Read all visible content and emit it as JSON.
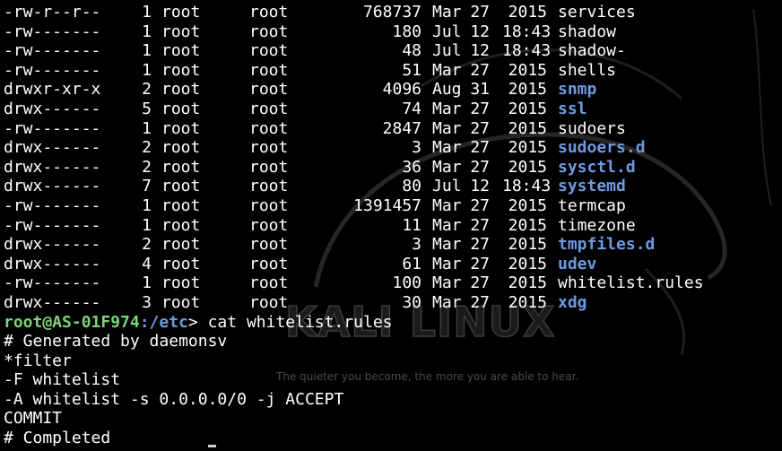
{
  "wallpaper": {
    "logo_text": "KALI LINUX",
    "tagline": "The quieter you become, the more you are able to hear."
  },
  "listing": [
    {
      "perm": "-rw-r--r--",
      "links": "1",
      "owner": "root",
      "group": "root",
      "size": "768737",
      "month": "Mar",
      "day": "27",
      "time": "2015",
      "name": "services",
      "is_dir": false
    },
    {
      "perm": "-rw-------",
      "links": "1",
      "owner": "root",
      "group": "root",
      "size": "180",
      "month": "Jul",
      "day": "12",
      "time": "18:43",
      "name": "shadow",
      "is_dir": false
    },
    {
      "perm": "-rw-------",
      "links": "1",
      "owner": "root",
      "group": "root",
      "size": "48",
      "month": "Jul",
      "day": "12",
      "time": "18:43",
      "name": "shadow-",
      "is_dir": false
    },
    {
      "perm": "-rw-------",
      "links": "1",
      "owner": "root",
      "group": "root",
      "size": "51",
      "month": "Mar",
      "day": "27",
      "time": "2015",
      "name": "shells",
      "is_dir": false
    },
    {
      "perm": "drwxr-xr-x",
      "links": "2",
      "owner": "root",
      "group": "root",
      "size": "4096",
      "month": "Aug",
      "day": "31",
      "time": "2015",
      "name": "snmp",
      "is_dir": true
    },
    {
      "perm": "drwx------",
      "links": "5",
      "owner": "root",
      "group": "root",
      "size": "74",
      "month": "Mar",
      "day": "27",
      "time": "2015",
      "name": "ssl",
      "is_dir": true
    },
    {
      "perm": "-rw-------",
      "links": "1",
      "owner": "root",
      "group": "root",
      "size": "2847",
      "month": "Mar",
      "day": "27",
      "time": "2015",
      "name": "sudoers",
      "is_dir": false
    },
    {
      "perm": "drwx------",
      "links": "2",
      "owner": "root",
      "group": "root",
      "size": "3",
      "month": "Mar",
      "day": "27",
      "time": "2015",
      "name": "sudoers.d",
      "is_dir": true
    },
    {
      "perm": "drwx------",
      "links": "2",
      "owner": "root",
      "group": "root",
      "size": "36",
      "month": "Mar",
      "day": "27",
      "time": "2015",
      "name": "sysctl.d",
      "is_dir": true
    },
    {
      "perm": "drwx------",
      "links": "7",
      "owner": "root",
      "group": "root",
      "size": "80",
      "month": "Jul",
      "day": "12",
      "time": "18:43",
      "name": "systemd",
      "is_dir": true
    },
    {
      "perm": "-rw-------",
      "links": "1",
      "owner": "root",
      "group": "root",
      "size": "1391457",
      "month": "Mar",
      "day": "27",
      "time": "2015",
      "name": "termcap",
      "is_dir": false
    },
    {
      "perm": "-rw-------",
      "links": "1",
      "owner": "root",
      "group": "root",
      "size": "11",
      "month": "Mar",
      "day": "27",
      "time": "2015",
      "name": "timezone",
      "is_dir": false
    },
    {
      "perm": "drwx------",
      "links": "2",
      "owner": "root",
      "group": "root",
      "size": "3",
      "month": "Mar",
      "day": "27",
      "time": "2015",
      "name": "tmpfiles.d",
      "is_dir": true
    },
    {
      "perm": "drwx------",
      "links": "4",
      "owner": "root",
      "group": "root",
      "size": "61",
      "month": "Mar",
      "day": "27",
      "time": "2015",
      "name": "udev",
      "is_dir": true
    },
    {
      "perm": "-rw-------",
      "links": "1",
      "owner": "root",
      "group": "root",
      "size": "100",
      "month": "Mar",
      "day": "27",
      "time": "2015",
      "name": "whitelist.rules",
      "is_dir": false
    },
    {
      "perm": "drwx------",
      "links": "3",
      "owner": "root",
      "group": "root",
      "size": "30",
      "month": "Mar",
      "day": "27",
      "time": "2015",
      "name": "xdg",
      "is_dir": true
    }
  ],
  "prompt": {
    "user_host": "root@AS-01F974",
    "path": ":/etc",
    "symbol": "> ",
    "command": "cat whitelist.rules"
  },
  "output": [
    "# Generated by daemonsv",
    "*filter",
    "-F whitelist",
    "-A whitelist -s 0.0.0.0/0 -j ACCEPT",
    "COMMIT",
    "# Completed"
  ],
  "colors": {
    "background": "#000000",
    "text": "#ffffff",
    "directory": "#6f9ae2",
    "prompt_user": "#7bd37a"
  }
}
